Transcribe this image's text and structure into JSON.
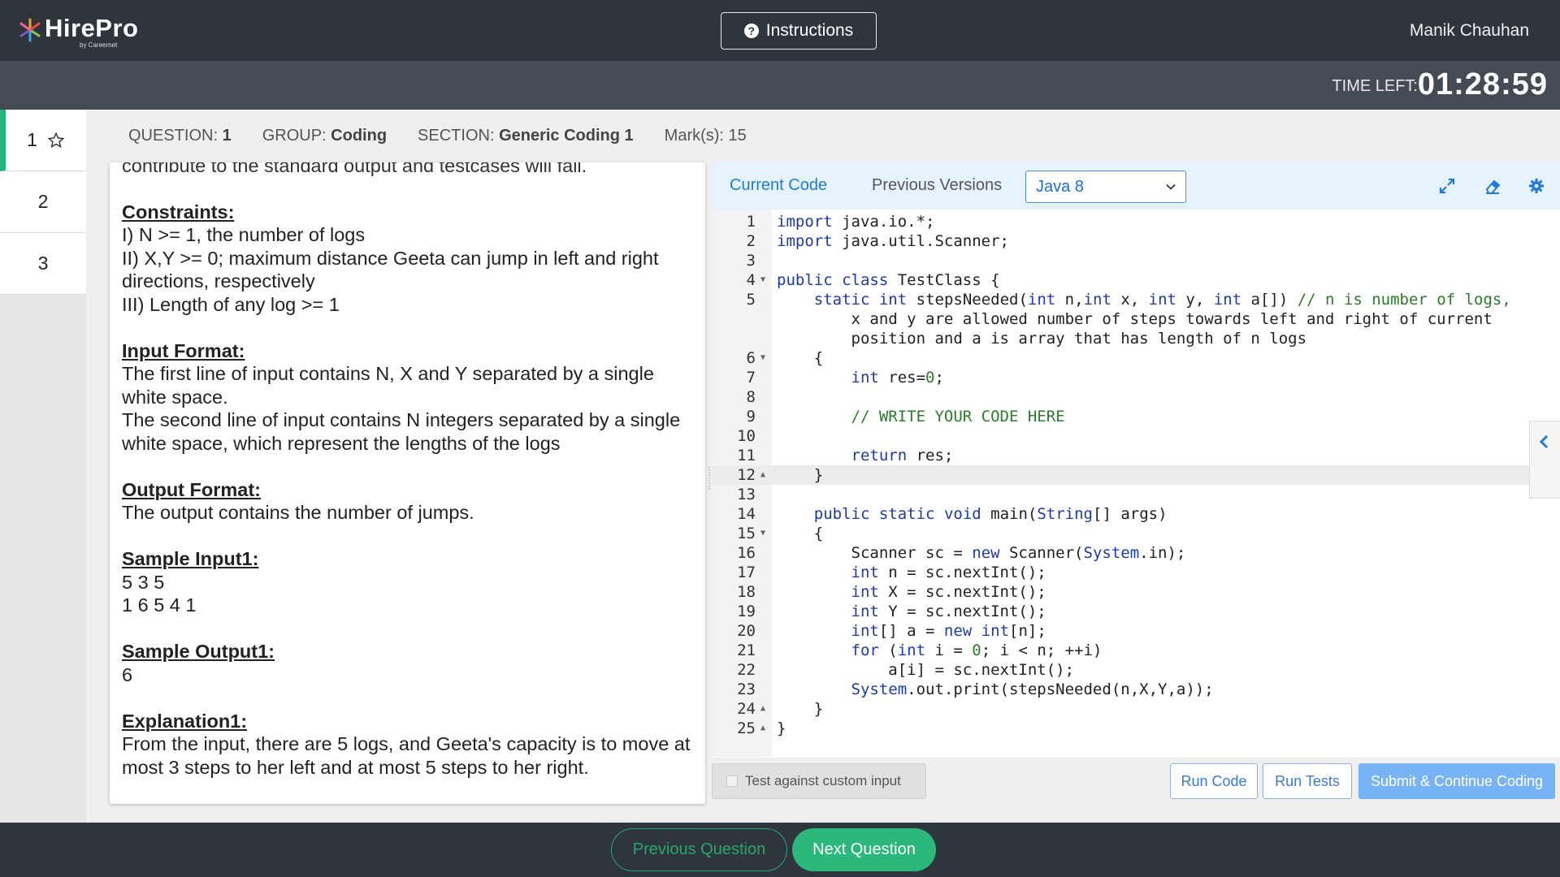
{
  "header": {
    "logo_text": "HirePro",
    "logo_sub": "by Careernet",
    "instructions_label": "Instructions",
    "user_name": "Manik Chauhan"
  },
  "timer": {
    "label": "TIME LEFT:",
    "value": "01:28:59"
  },
  "question_nav": [
    "1",
    "2",
    "3"
  ],
  "question_info": {
    "question_label": "QUESTION:",
    "question_value": "1",
    "group_label": "GROUP:",
    "group_value": "Coding",
    "section_label": "SECTION:",
    "section_value": "Generic Coding 1",
    "marks_label": "Mark(s):",
    "marks_value": "15"
  },
  "problem": {
    "cut_line": "contribute to the standard output and testcases will fail.",
    "constraints_h": "Constraints:",
    "c1": "I) N >= 1, the number of logs",
    "c2": "II) X,Y >= 0; maximum distance Geeta can jump in left and right directions, respectively",
    "c3": "III) Length of any log >= 1",
    "input_h": "Input Format:",
    "in1": "The first line of input contains N, X and Y separated by a single white space.",
    "in2": "The second line of input contains N integers separated by a single white space, which represent the lengths of the logs",
    "output_h": "Output Format:",
    "out1": "The output contains the number of jumps.",
    "sample_in_h": "Sample Input1:",
    "si1": "5 3 5",
    "si2": "1 6 5 4 1",
    "sample_out_h": "Sample Output1:",
    "so1": "6",
    "expl_h": "Explanation1:",
    "ex1": "From the input, there are 5 logs, and Geeta's capacity is to move at most 3 steps to her left and at most 5 steps to her right."
  },
  "editor": {
    "tab_current": "Current Code",
    "tab_previous": "Previous Versions",
    "language": "Java 8",
    "lines": [
      {
        "n": "1",
        "t": "import java.io.*;"
      },
      {
        "n": "2",
        "t": "import java.util.Scanner;"
      },
      {
        "n": "3",
        "t": ""
      },
      {
        "n": "4",
        "t": "public class TestClass {"
      },
      {
        "n": "5",
        "t": "    static int stepsNeeded(int n,int x, int y, int a[]) // n is number of logs,"
      },
      {
        "n": "",
        "t": "        x and y are allowed number of steps towards left and right of current"
      },
      {
        "n": "",
        "t": "        position and a is array that has length of n logs"
      },
      {
        "n": "6",
        "t": "    {"
      },
      {
        "n": "7",
        "t": "        int res=0;"
      },
      {
        "n": "8",
        "t": ""
      },
      {
        "n": "9",
        "t": "        // WRITE YOUR CODE HERE"
      },
      {
        "n": "10",
        "t": ""
      },
      {
        "n": "11",
        "t": "        return res;"
      },
      {
        "n": "12",
        "t": "    }"
      },
      {
        "n": "13",
        "t": ""
      },
      {
        "n": "14",
        "t": "    public static void main(String[] args)"
      },
      {
        "n": "15",
        "t": "    {"
      },
      {
        "n": "16",
        "t": "        Scanner sc = new Scanner(System.in);"
      },
      {
        "n": "17",
        "t": "        int n = sc.nextInt();"
      },
      {
        "n": "18",
        "t": "        int X = sc.nextInt();"
      },
      {
        "n": "19",
        "t": "        int Y = sc.nextInt();"
      },
      {
        "n": "20",
        "t": "        int[] a = new int[n];"
      },
      {
        "n": "21",
        "t": "        for (int i = 0; i < n; ++i)"
      },
      {
        "n": "22",
        "t": "            a[i] = sc.nextInt();"
      },
      {
        "n": "23",
        "t": "        System.out.print(stepsNeeded(n,X,Y,a));"
      },
      {
        "n": "24",
        "t": "    }"
      },
      {
        "n": "25",
        "t": "}"
      }
    ]
  },
  "actions": {
    "custom_input": "Test against custom input",
    "run_code": "Run Code",
    "run_tests": "Run Tests",
    "submit": "Submit & Continue Coding"
  },
  "footer": {
    "prev": "Previous Question",
    "next": "Next Question"
  },
  "colors": {
    "accent_green": "#2ab87c",
    "accent_blue": "#1f7ad8",
    "header_bg": "#2f353d"
  }
}
